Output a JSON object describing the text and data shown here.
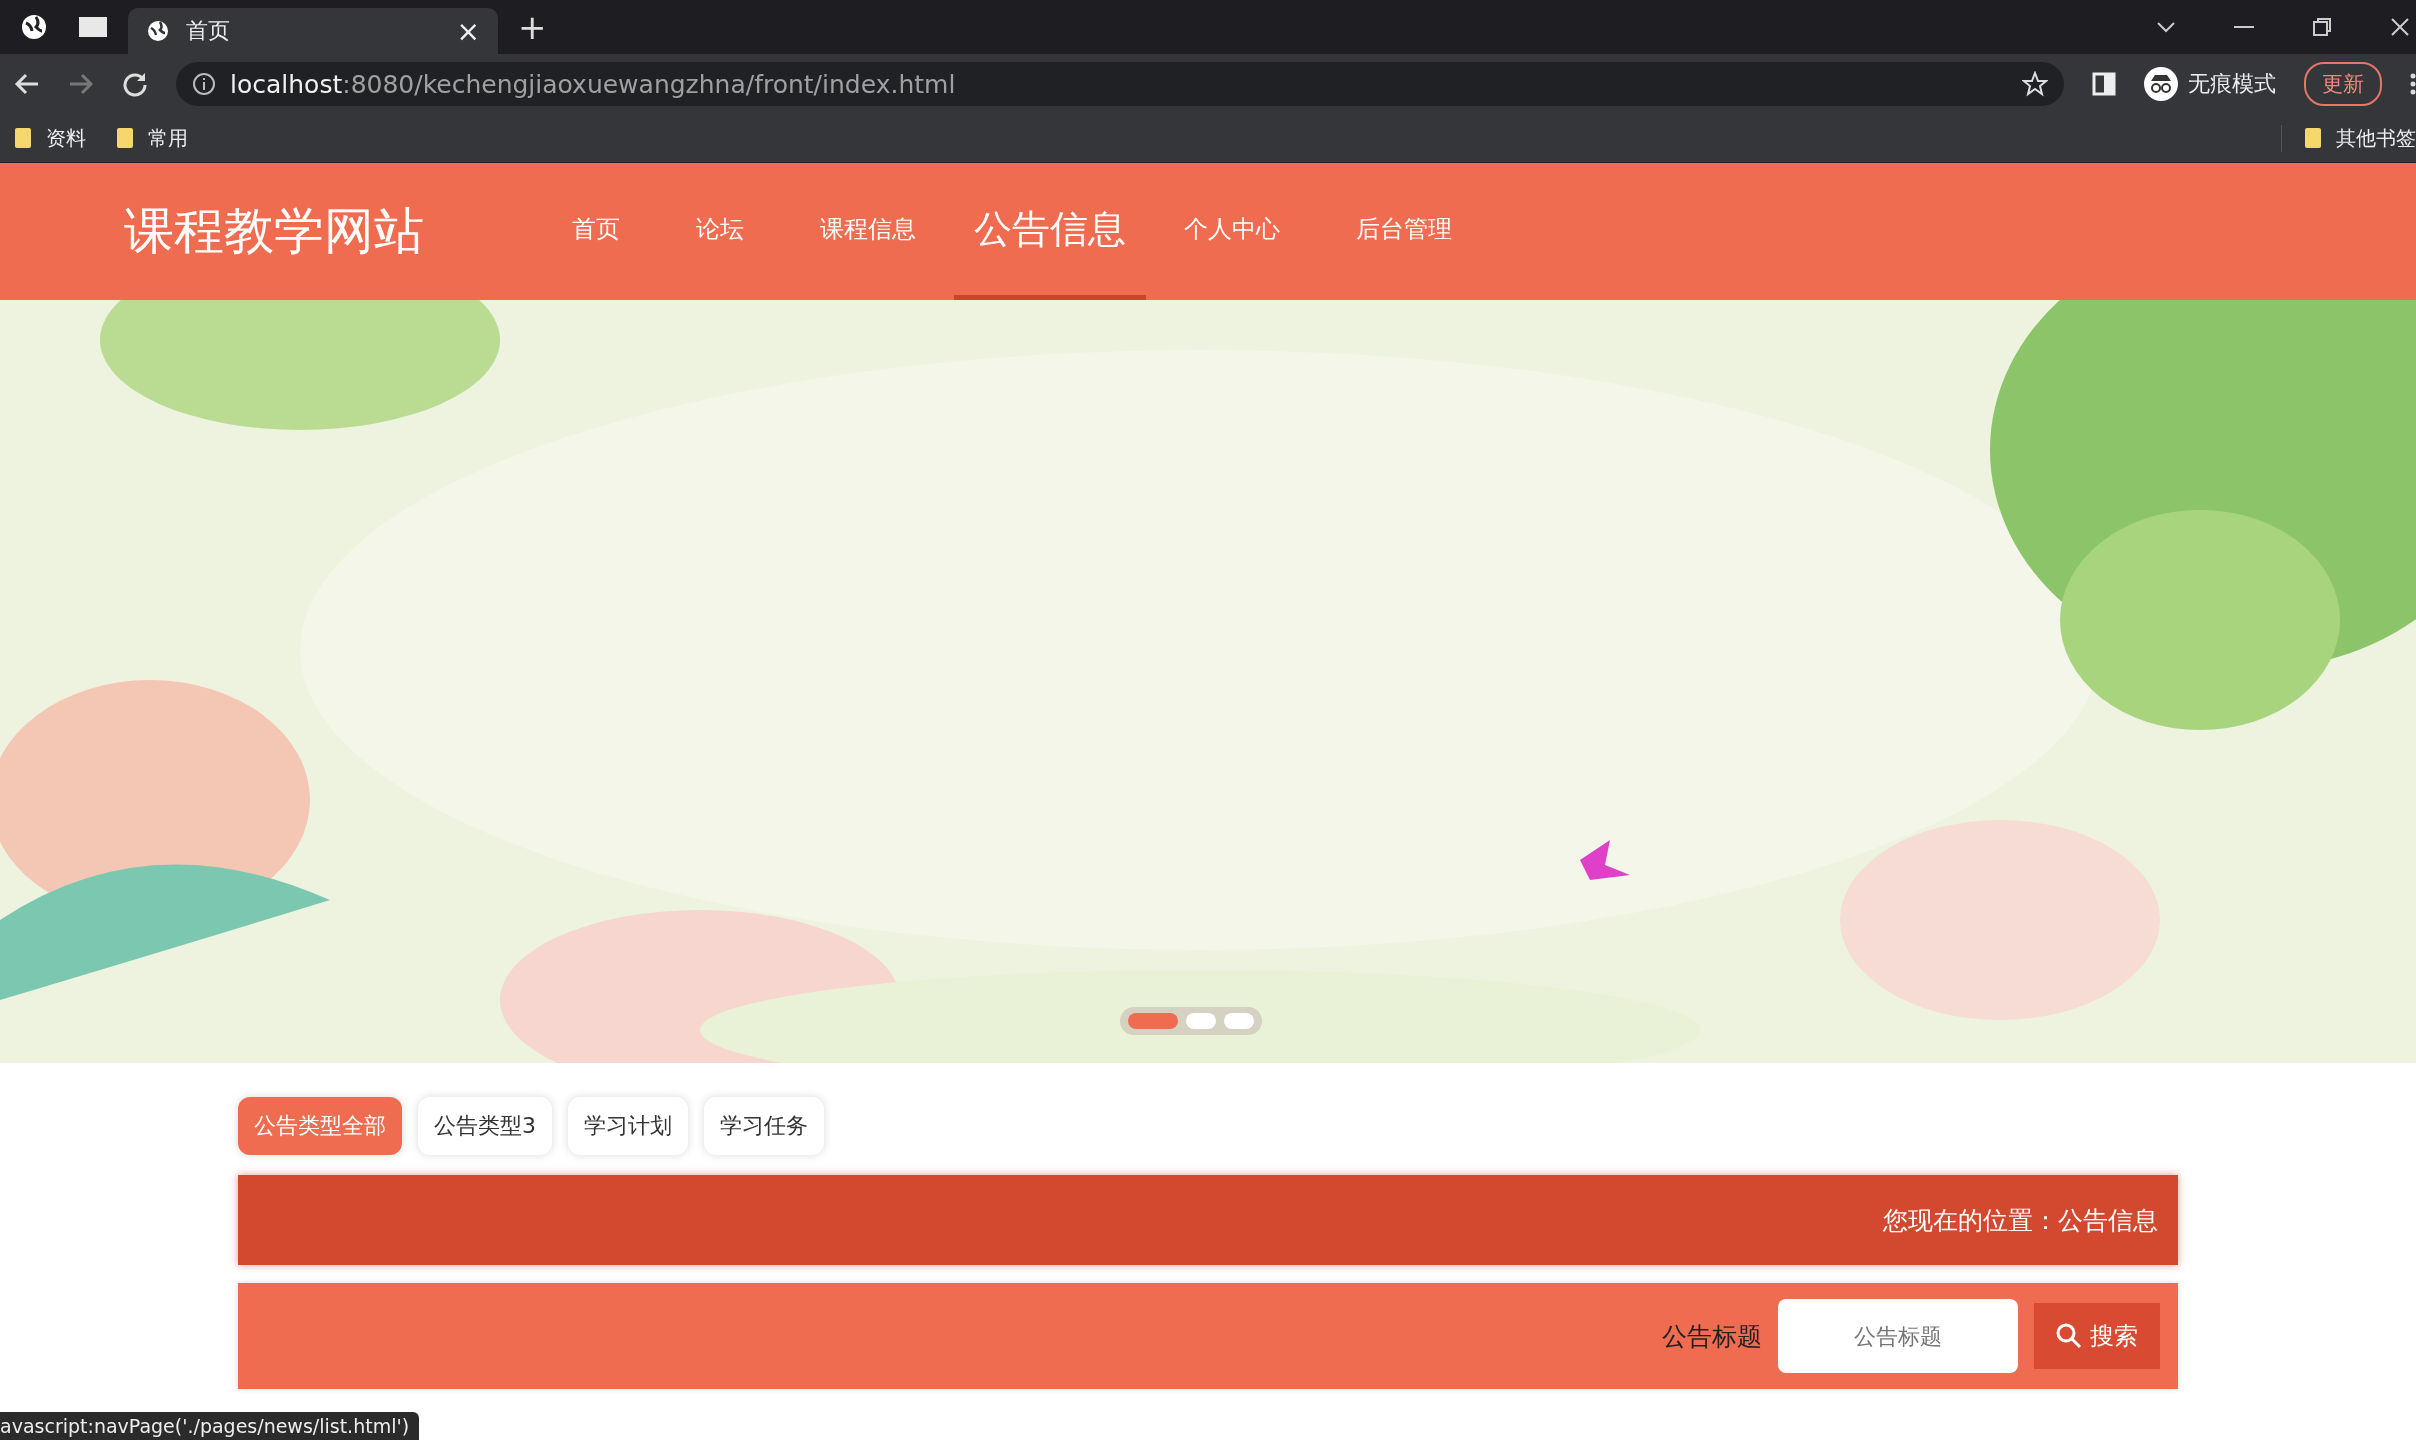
{
  "browser": {
    "tab_title": "首页",
    "tab_close": "×",
    "new_tab": "+",
    "address": {
      "host": "localhost",
      "path": ":8080/kechengjiaoxuewangzhna/front/index.html"
    },
    "incognito": "无痕模式",
    "update": "更新",
    "bookmarks": [
      {
        "label": "资料"
      },
      {
        "label": "常用"
      }
    ],
    "other_bookmarks": "其他书签"
  },
  "site": {
    "logo": "课程教学网站",
    "nav": [
      {
        "label": "首页",
        "selected": false
      },
      {
        "label": "论坛",
        "selected": false
      },
      {
        "label": "课程信息",
        "selected": false
      },
      {
        "label": "公告信息",
        "selected": true
      },
      {
        "label": "个人中心",
        "selected": false
      },
      {
        "label": "后台管理",
        "selected": false
      }
    ]
  },
  "banner": {
    "dots": [
      {
        "selected": true
      },
      {
        "selected": false
      },
      {
        "selected": false
      }
    ]
  },
  "categories": [
    {
      "label": "公告类型全部",
      "selected": true
    },
    {
      "label": "公告类型3",
      "selected": false
    },
    {
      "label": "学习计划",
      "selected": false
    },
    {
      "label": "学习任务",
      "selected": false
    }
  ],
  "breadcrumb": {
    "label": "您现在的位置：",
    "current": "公告信息"
  },
  "search": {
    "label": "公告标题",
    "placeholder": "公告标题",
    "button": "搜索"
  },
  "status_bar": "avascript:navPage('./pages/news/list.html')"
}
